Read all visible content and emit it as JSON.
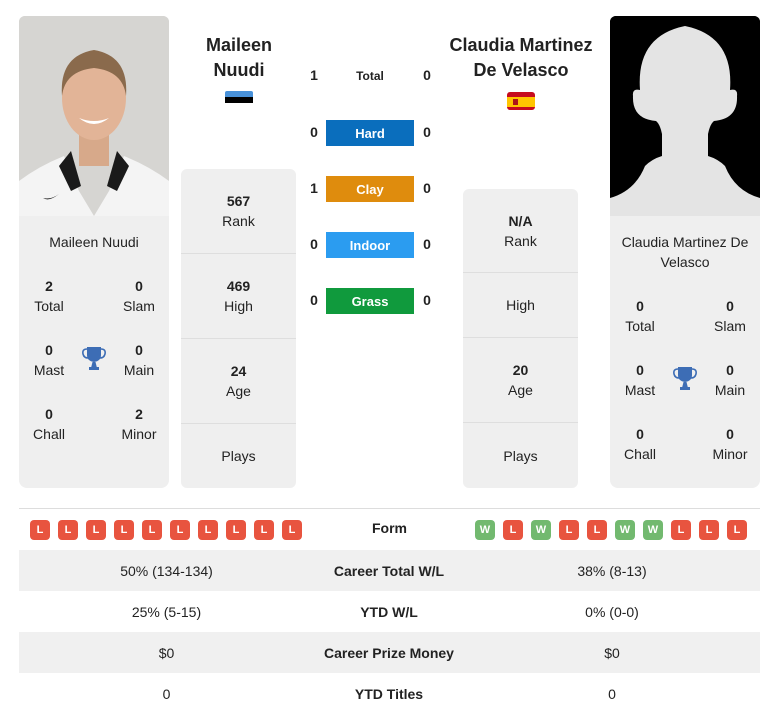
{
  "player_left": {
    "name": "Maileen Nuudi",
    "name_line1": "Maileen",
    "name_line2": "Nuudi",
    "country": "Estonia",
    "flag_colors": [
      "#4891d9",
      "#000000",
      "#ffffff"
    ],
    "titles": {
      "total": {
        "value": "2",
        "label": "Total"
      },
      "slam": {
        "value": "0",
        "label": "Slam"
      },
      "mast": {
        "value": "0",
        "label": "Mast"
      },
      "main": {
        "value": "0",
        "label": "Main"
      },
      "chall": {
        "value": "0",
        "label": "Chall"
      },
      "minor": {
        "value": "2",
        "label": "Minor"
      }
    },
    "stats": {
      "rank": {
        "value": "567",
        "label": "Rank"
      },
      "high": {
        "value": "469",
        "label": "High"
      },
      "age": {
        "value": "24",
        "label": "Age"
      },
      "plays": {
        "value": "",
        "label": "Plays"
      }
    },
    "form": [
      "L",
      "L",
      "L",
      "L",
      "L",
      "L",
      "L",
      "L",
      "L",
      "L"
    ]
  },
  "player_right": {
    "name": "Claudia Martinez De Velasco",
    "name_line1": "Claudia Martinez",
    "name_line2": "De Velasco",
    "card_name_line1": "Claudia Martinez De",
    "card_name_line2": "Velasco",
    "country": "Spain",
    "flag_colors": [
      "#c60b1e",
      "#ffc400"
    ],
    "titles": {
      "total": {
        "value": "0",
        "label": "Total"
      },
      "slam": {
        "value": "0",
        "label": "Slam"
      },
      "mast": {
        "value": "0",
        "label": "Mast"
      },
      "main": {
        "value": "0",
        "label": "Main"
      },
      "chall": {
        "value": "0",
        "label": "Chall"
      },
      "minor": {
        "value": "0",
        "label": "Minor"
      }
    },
    "stats": {
      "rank": {
        "value": "N/A",
        "label": "Rank"
      },
      "high": {
        "value": "",
        "label": "High"
      },
      "age": {
        "value": "20",
        "label": "Age"
      },
      "plays": {
        "value": "",
        "label": "Plays"
      }
    },
    "form": [
      "W",
      "L",
      "W",
      "L",
      "L",
      "W",
      "W",
      "L",
      "L",
      "L"
    ]
  },
  "head_to_head": [
    {
      "surface": "Total",
      "left": "1",
      "right": "0",
      "color": ""
    },
    {
      "surface": "Hard",
      "left": "0",
      "right": "0",
      "color": "#0a6ebd"
    },
    {
      "surface": "Clay",
      "left": "1",
      "right": "0",
      "color": "#df8c0d"
    },
    {
      "surface": "Indoor",
      "left": "0",
      "right": "0",
      "color": "#2b9cf0"
    },
    {
      "surface": "Grass",
      "left": "0",
      "right": "0",
      "color": "#109a3d"
    }
  ],
  "form_label": "Form",
  "comparison": [
    {
      "label": "Career Total W/L",
      "left": "50% (134-134)",
      "right": "38% (8-13)"
    },
    {
      "label": "YTD W/L",
      "left": "25% (5-15)",
      "right": "0% (0-0)"
    },
    {
      "label": "Career Prize Money",
      "left": "$0",
      "right": "$0"
    },
    {
      "label": "YTD Titles",
      "left": "0",
      "right": "0"
    }
  ],
  "colors": {
    "loss": "#e8543f",
    "win": "#72b96f",
    "trophy": "#3d6db5",
    "card_bg": "#efefef"
  }
}
